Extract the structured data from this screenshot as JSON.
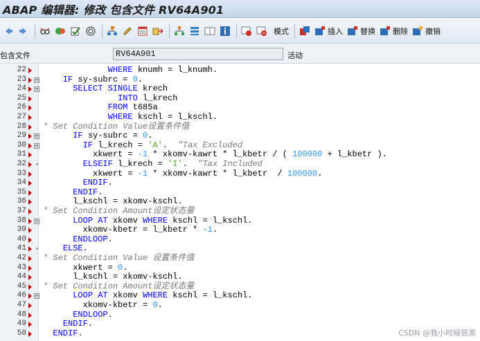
{
  "window": {
    "title": "ABAP 编辑器: 修改 包含文件 RV64A901"
  },
  "toolbar": {
    "pattern_label": "模式",
    "insert_label": "插入",
    "replace_label": "替换",
    "delete_label": "删除",
    "undo_label": "撤销"
  },
  "include": {
    "label": "包含文件",
    "value": "RV64A901",
    "status": "活动"
  },
  "editor": {
    "lines": [
      {
        "no": "22",
        "code": [
          {
            "t": "             "
          },
          {
            "t": "WHERE",
            "k": "kw"
          },
          {
            "t": " knumh = l_knumh."
          }
        ]
      },
      {
        "no": "23",
        "fold": "⊟",
        "code": [
          {
            "t": "    "
          },
          {
            "t": "IF",
            "k": "kw"
          },
          {
            "t": " sy-subrc = "
          },
          {
            "t": "0",
            "k": "num"
          },
          {
            "t": "."
          }
        ]
      },
      {
        "no": "24",
        "fold": "⊟",
        "code": [
          {
            "t": "      "
          },
          {
            "t": "SELECT SINGLE",
            "k": "kw"
          },
          {
            "t": " krech"
          }
        ]
      },
      {
        "no": "25",
        "code": [
          {
            "t": "               "
          },
          {
            "t": "INTO",
            "k": "kw"
          },
          {
            "t": " l_krech"
          }
        ]
      },
      {
        "no": "26",
        "code": [
          {
            "t": "             "
          },
          {
            "t": "FROM",
            "k": "kw"
          },
          {
            "t": " t685a"
          }
        ]
      },
      {
        "no": "27",
        "code": [
          {
            "t": "             "
          },
          {
            "t": "WHERE",
            "k": "kw"
          },
          {
            "t": " kschl = l_kschl."
          }
        ]
      },
      {
        "no": "28",
        "code": [
          {
            "t": "* Set Condition Value设置条件值",
            "k": "cmt"
          }
        ]
      },
      {
        "no": "29",
        "fold": "⊟",
        "code": [
          {
            "t": "      "
          },
          {
            "t": "IF",
            "k": "kw"
          },
          {
            "t": " sy-subrc = "
          },
          {
            "t": "0",
            "k": "num"
          },
          {
            "t": "."
          }
        ]
      },
      {
        "no": "30",
        "fold": "⊟",
        "code": [
          {
            "t": "        "
          },
          {
            "t": "IF",
            "k": "kw"
          },
          {
            "t": " l_krech = "
          },
          {
            "t": "'A'",
            "k": "str"
          },
          {
            "t": ".  "
          },
          {
            "t": "\"Tax Excluded",
            "k": "cmt"
          }
        ]
      },
      {
        "no": "31",
        "code": [
          {
            "t": "          xkwert = "
          },
          {
            "t": "-1",
            "k": "num"
          },
          {
            "t": " * xkomv-kawrt * l_kbetr / ( "
          },
          {
            "t": "100000",
            "k": "num"
          },
          {
            "t": " + l_kbetr )."
          }
        ]
      },
      {
        "no": "32",
        "dot": true,
        "code": [
          {
            "t": "        "
          },
          {
            "t": "ELSEIF",
            "k": "kw"
          },
          {
            "t": " l_krech = "
          },
          {
            "t": "'I'",
            "k": "str"
          },
          {
            "t": ".  "
          },
          {
            "t": "\"Tax Included",
            "k": "cmt"
          }
        ]
      },
      {
        "no": "33",
        "code": [
          {
            "t": "          xkwert = "
          },
          {
            "t": "-1",
            "k": "num"
          },
          {
            "t": " * xkomv-kawrt * l_kbetr  / "
          },
          {
            "t": "100000",
            "k": "num"
          },
          {
            "t": "."
          }
        ]
      },
      {
        "no": "34",
        "code": [
          {
            "t": "        "
          },
          {
            "t": "ENDIF",
            "k": "kw"
          },
          {
            "t": "."
          }
        ]
      },
      {
        "no": "35",
        "code": [
          {
            "t": "      "
          },
          {
            "t": "ENDIF",
            "k": "kw"
          },
          {
            "t": "."
          }
        ]
      },
      {
        "no": "36",
        "code": [
          {
            "t": "      l_kschl = xkomv-kschl."
          }
        ]
      },
      {
        "no": "37",
        "code": [
          {
            "t": "* Set Condition Amount设定状态量",
            "k": "cmt"
          }
        ]
      },
      {
        "no": "38",
        "fold": "⊟",
        "code": [
          {
            "t": "      "
          },
          {
            "t": "LOOP AT",
            "k": "kw"
          },
          {
            "t": " xkomv "
          },
          {
            "t": "WHERE",
            "k": "kw"
          },
          {
            "t": " kschl = l_kschl."
          }
        ]
      },
      {
        "no": "39",
        "code": [
          {
            "t": "        xkomv-kbetr = l_kbetr * "
          },
          {
            "t": "-1",
            "k": "num"
          },
          {
            "t": "."
          }
        ]
      },
      {
        "no": "40",
        "code": [
          {
            "t": "      "
          },
          {
            "t": "ENDLOOP",
            "k": "kw"
          },
          {
            "t": "."
          }
        ]
      },
      {
        "no": "41",
        "dot": true,
        "code": [
          {
            "t": "    "
          },
          {
            "t": "ELSE",
            "k": "kw"
          },
          {
            "t": "."
          }
        ]
      },
      {
        "no": "42",
        "code": [
          {
            "t": "* Set Condition Value 设置条件值",
            "k": "cmt"
          }
        ]
      },
      {
        "no": "43",
        "code": [
          {
            "t": "      xkwert = "
          },
          {
            "t": "0",
            "k": "num"
          },
          {
            "t": "."
          }
        ]
      },
      {
        "no": "44",
        "code": [
          {
            "t": "      l_kschl = xkomv-kschl."
          }
        ]
      },
      {
        "no": "45",
        "code": [
          {
            "t": "* Set Condition Amount设定状态量",
            "k": "cmt"
          }
        ]
      },
      {
        "no": "46",
        "fold": "⊟",
        "code": [
          {
            "t": "      "
          },
          {
            "t": "LOOP AT",
            "k": "kw"
          },
          {
            "t": " xkomv "
          },
          {
            "t": "WHERE",
            "k": "kw"
          },
          {
            "t": " kschl = l_kschl."
          }
        ]
      },
      {
        "no": "47",
        "code": [
          {
            "t": "        xkomv-kbetr = "
          },
          {
            "t": "0",
            "k": "num"
          },
          {
            "t": "."
          }
        ]
      },
      {
        "no": "48",
        "code": [
          {
            "t": "      "
          },
          {
            "t": "ENDLOOP",
            "k": "kw"
          },
          {
            "t": "."
          }
        ]
      },
      {
        "no": "49",
        "code": [
          {
            "t": "    "
          },
          {
            "t": "ENDIF",
            "k": "kw"
          },
          {
            "t": "."
          }
        ]
      },
      {
        "no": "50",
        "code": [
          {
            "t": "  "
          },
          {
            "t": "ENDIF",
            "k": "kw"
          },
          {
            "t": "."
          }
        ]
      }
    ]
  },
  "watermark": "CSDN @我小时候很黑"
}
